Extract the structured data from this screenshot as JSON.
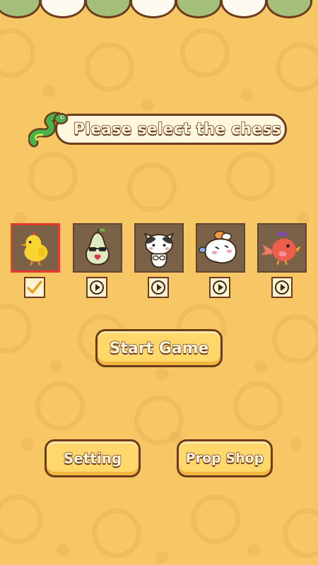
{
  "title": "Please select the chess",
  "chess": [
    {
      "name": "chick",
      "selected": true,
      "status": "selected"
    },
    {
      "name": "pear",
      "selected": false,
      "status": "video"
    },
    {
      "name": "cat",
      "selected": false,
      "status": "video"
    },
    {
      "name": "rabbit",
      "selected": false,
      "status": "video"
    },
    {
      "name": "bird",
      "selected": false,
      "status": "video"
    }
  ],
  "buttons": {
    "start_game": "Start Game",
    "setting": "Setting",
    "prop_shop": "Prop Shop"
  },
  "colors": {
    "background": "#f8c765",
    "outline": "#6b3b1c",
    "button": "#ffd76b",
    "selected_border": "#e83a2c"
  }
}
